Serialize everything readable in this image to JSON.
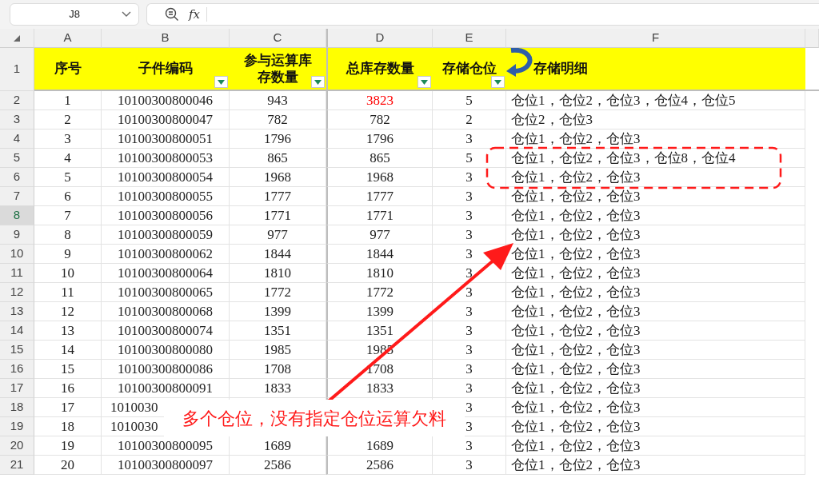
{
  "name_box": {
    "value": "J8"
  },
  "formula_bar": {
    "function_label": "fx"
  },
  "column_letters": [
    "A",
    "B",
    "C",
    "D",
    "E",
    "F"
  ],
  "header_row": {
    "number": "1",
    "cells": [
      {
        "text": "序号",
        "filter": false
      },
      {
        "text": "子件编码",
        "filter": true
      },
      {
        "text": "参与运算库存数量",
        "filter": true
      },
      {
        "text": "总库存数量",
        "filter": true
      },
      {
        "text": "存储仓位",
        "filter": true
      },
      {
        "text": "存储明细",
        "filter": false
      }
    ]
  },
  "rows": [
    {
      "number": "2",
      "selected": false,
      "a": "1",
      "b": "10100300800046",
      "c": "943",
      "d": {
        "text": "3823",
        "color": "#ff0000"
      },
      "e": "5",
      "f": "仓位1，仓位2，仓位3，仓位4，仓位5"
    },
    {
      "number": "3",
      "selected": false,
      "a": "2",
      "b": "10100300800047",
      "c": "782",
      "d": "782",
      "e": "2",
      "f": "仓位2，仓位3"
    },
    {
      "number": "4",
      "selected": false,
      "a": "3",
      "b": "10100300800051",
      "c": "1796",
      "d": "1796",
      "e": "3",
      "f": "仓位1，仓位2，仓位3"
    },
    {
      "number": "5",
      "selected": false,
      "a": "4",
      "b": "10100300800053",
      "c": "865",
      "d": "865",
      "e": "5",
      "f": "仓位1，仓位2，仓位3，仓位8，仓位4"
    },
    {
      "number": "6",
      "selected": false,
      "a": "5",
      "b": "10100300800054",
      "c": "1968",
      "d": "1968",
      "e": "3",
      "f": "仓位1，仓位2，仓位3"
    },
    {
      "number": "7",
      "selected": false,
      "a": "6",
      "b": "10100300800055",
      "c": "1777",
      "d": "1777",
      "e": "3",
      "f": "仓位1，仓位2，仓位3"
    },
    {
      "number": "8",
      "selected": true,
      "a": "7",
      "b": "10100300800056",
      "c": "1771",
      "d": "1771",
      "e": "3",
      "f": "仓位1，仓位2，仓位3"
    },
    {
      "number": "9",
      "selected": false,
      "a": "8",
      "b": "10100300800059",
      "c": "977",
      "d": "977",
      "e": "3",
      "f": "仓位1，仓位2，仓位3"
    },
    {
      "number": "10",
      "selected": false,
      "a": "9",
      "b": "10100300800062",
      "c": "1844",
      "d": "1844",
      "e": "3",
      "f": "仓位1，仓位2，仓位3"
    },
    {
      "number": "11",
      "selected": false,
      "a": "10",
      "b": "10100300800064",
      "c": "1810",
      "d": "1810",
      "e": "3",
      "f": "仓位1，仓位2，仓位3"
    },
    {
      "number": "12",
      "selected": false,
      "a": "11",
      "b": "10100300800065",
      "c": "1772",
      "d": "1772",
      "e": "3",
      "f": "仓位1，仓位2，仓位3"
    },
    {
      "number": "13",
      "selected": false,
      "a": "12",
      "b": "10100300800068",
      "c": "1399",
      "d": "1399",
      "e": "3",
      "f": "仓位1，仓位2，仓位3"
    },
    {
      "number": "14",
      "selected": false,
      "a": "13",
      "b": "10100300800074",
      "c": "1351",
      "d": "1351",
      "e": "3",
      "f": "仓位1，仓位2，仓位3"
    },
    {
      "number": "15",
      "selected": false,
      "a": "14",
      "b": "10100300800080",
      "c": "1985",
      "d": "1985",
      "e": "3",
      "f": "仓位1，仓位2，仓位3"
    },
    {
      "number": "16",
      "selected": false,
      "a": "15",
      "b": "10100300800086",
      "c": "1708",
      "d": "1708",
      "e": "3",
      "f": "仓位1，仓位2，仓位3"
    },
    {
      "number": "17",
      "selected": false,
      "a": "16",
      "b": "10100300800091",
      "c": "1833",
      "d": "1833",
      "e": "3",
      "f": "仓位1，仓位2，仓位3"
    },
    {
      "number": "18",
      "selected": false,
      "a": "17",
      "b": "1010030",
      "e": "3",
      "f": "仓位1，仓位2，仓位3"
    },
    {
      "number": "19",
      "selected": false,
      "a": "18",
      "b": "1010030",
      "e": "3",
      "f": "仓位1，仓位2，仓位3"
    },
    {
      "number": "20",
      "selected": false,
      "a": "19",
      "b": "10100300800095",
      "c": "1689",
      "d": "1689",
      "e": "3",
      "f": "仓位1，仓位2，仓位3"
    },
    {
      "number": "21",
      "selected": false,
      "a": "20",
      "b": "10100300800097",
      "c": "2586",
      "d": "2586",
      "e": "3",
      "f": "仓位1，仓位2，仓位3"
    }
  ],
  "callout": {
    "text": "多个仓位，没有指定仓位运算欠料"
  }
}
